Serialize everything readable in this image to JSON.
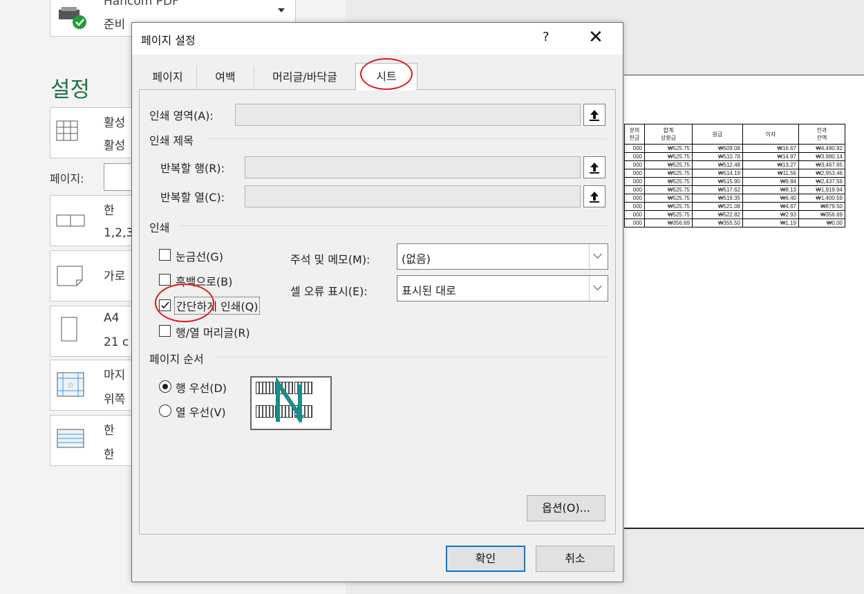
{
  "backstage": {
    "printer_name": "Hancom PDF",
    "printer_status": "준비",
    "settings_title": "설정",
    "items": [
      {
        "line1": "활성",
        "line2": "활성"
      },
      {
        "line1": "한 ",
        "line2": "1,2,3"
      },
      {
        "line1": "가로",
        "line2": ""
      },
      {
        "line1": "A4",
        "line2": "21 c"
      },
      {
        "line1": "마지",
        "line2": "위쪽"
      },
      {
        "line1": "한 ",
        "line2": "한 "
      }
    ],
    "pages_label": "페이지:"
  },
  "preview": {
    "headers": [
      "분의\n한금",
      "합계\n상환금",
      "원금",
      "이자",
      "잔과\n잔액"
    ],
    "rows": [
      [
        "000",
        "₩525.75",
        "₩509.08",
        "₩16.67",
        "₩4,490.92"
      ],
      [
        "000",
        "₩525.75",
        "₩510.78",
        "₩14.97",
        "₩3,980.14"
      ],
      [
        "000",
        "₩525.75",
        "₩512.48",
        "₩13.27",
        "₩3,467.65"
      ],
      [
        "000",
        "₩525.75",
        "₩514.19",
        "₩11.56",
        "₩2,953.46"
      ],
      [
        "000",
        "₩525.75",
        "₩515.90",
        "₩9.84",
        "₩2,437.56"
      ],
      [
        "000",
        "₩525.75",
        "₩517.62",
        "₩8.13",
        "₩1,919.94"
      ],
      [
        "000",
        "₩525.75",
        "₩519.35",
        "₩6.40",
        "₩1,400.59"
      ],
      [
        "000",
        "₩525.75",
        "₩521.08",
        "₩4.67",
        "₩879.50"
      ],
      [
        "000",
        "₩525.75",
        "₩522.82",
        "₩2.93",
        "₩356.69"
      ],
      [
        "000",
        "₩356.69",
        "₩355.50",
        "₩1.19",
        "₩0.00"
      ]
    ]
  },
  "dialog": {
    "title": "페이지 설정",
    "help": "?",
    "close": "✕",
    "tabs": [
      "페이지",
      "여백",
      "머리글/바닥글",
      "시트"
    ],
    "print_area_label": "인쇄 영역(A):",
    "print_titles_group": "인쇄 제목",
    "rows_repeat_label": "반복할 행(R):",
    "cols_repeat_label": "반복할 열(C):",
    "print_group": "인쇄",
    "gridlines": "눈금선(G)",
    "bw": "흑백으로(B)",
    "draft": "간단하게 인쇄(Q)",
    "headings": "행/열 머리글(R)",
    "comments_label": "주석 및 메모(M):",
    "comments_value": "(없음)",
    "errors_label": "셀 오류 표시(E):",
    "errors_value": "표시된 대로",
    "page_order_group": "페이지 순서",
    "down_then_over": "행 우선(D)",
    "over_then_down": "열 우선(V)",
    "options_btn": "옵션(O)...",
    "ok_btn": "확인",
    "cancel_btn": "취소"
  },
  "colors": {
    "accent": "#217346",
    "highlight": "#e0161b",
    "focus": "#0078d7"
  }
}
